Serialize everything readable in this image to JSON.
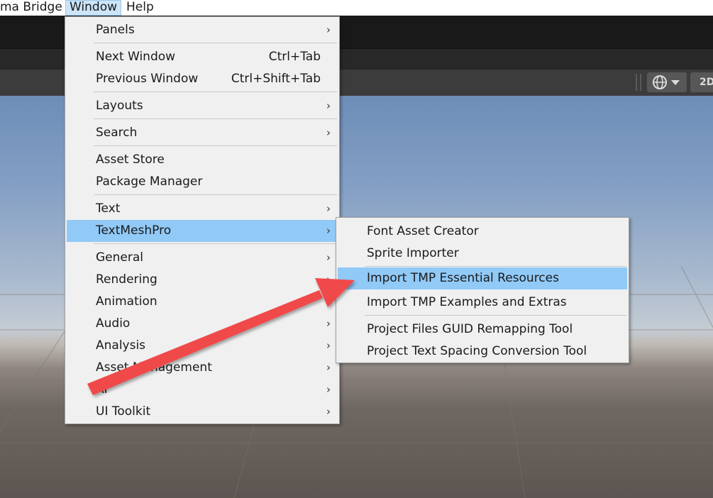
{
  "menubar": {
    "items": [
      {
        "label": "ma Bridge"
      },
      {
        "label": "Window"
      },
      {
        "label": "Help"
      }
    ]
  },
  "toolbar": {
    "globe_icon": "globe-icon",
    "dropdown_icon": "caret-down-icon",
    "mode_2d_label": "2D"
  },
  "window_menu": {
    "items": [
      {
        "label": "Panels",
        "submenu": true
      },
      {
        "label": "Next Window",
        "shortcut": "Ctrl+Tab"
      },
      {
        "label": "Previous Window",
        "shortcut": "Ctrl+Shift+Tab"
      },
      {
        "label": "Layouts",
        "submenu": true
      },
      {
        "label": "Search",
        "submenu": true
      },
      {
        "label": "Asset Store"
      },
      {
        "label": "Package Manager"
      },
      {
        "label": "Text",
        "submenu": true
      },
      {
        "label": "TextMeshPro",
        "submenu": true,
        "highlighted": true
      },
      {
        "label": "General",
        "submenu": true
      },
      {
        "label": "Rendering",
        "submenu": true
      },
      {
        "label": "Animation",
        "submenu": true
      },
      {
        "label": "Audio",
        "submenu": true
      },
      {
        "label": "Analysis",
        "submenu": true
      },
      {
        "label": "Asset Management",
        "submenu": true
      },
      {
        "label": "AI",
        "submenu": true
      },
      {
        "label": "UI Toolkit",
        "submenu": true
      }
    ],
    "submenu_arrow": "›"
  },
  "textmeshpro_submenu": {
    "items": [
      {
        "label": "Font Asset Creator"
      },
      {
        "label": "Sprite Importer"
      },
      {
        "label": "Import TMP Essential Resources",
        "highlighted": true
      },
      {
        "label": "Import TMP Examples and Extras"
      },
      {
        "label": "Project Files GUID Remapping Tool"
      },
      {
        "label": "Project Text Spacing Conversion Tool"
      }
    ]
  },
  "colors": {
    "highlight": "#91c9f7",
    "menu_bg": "#f0f0f0",
    "annotation_arrow": "#f0484a",
    "menubar_active": "#cce4f7"
  }
}
